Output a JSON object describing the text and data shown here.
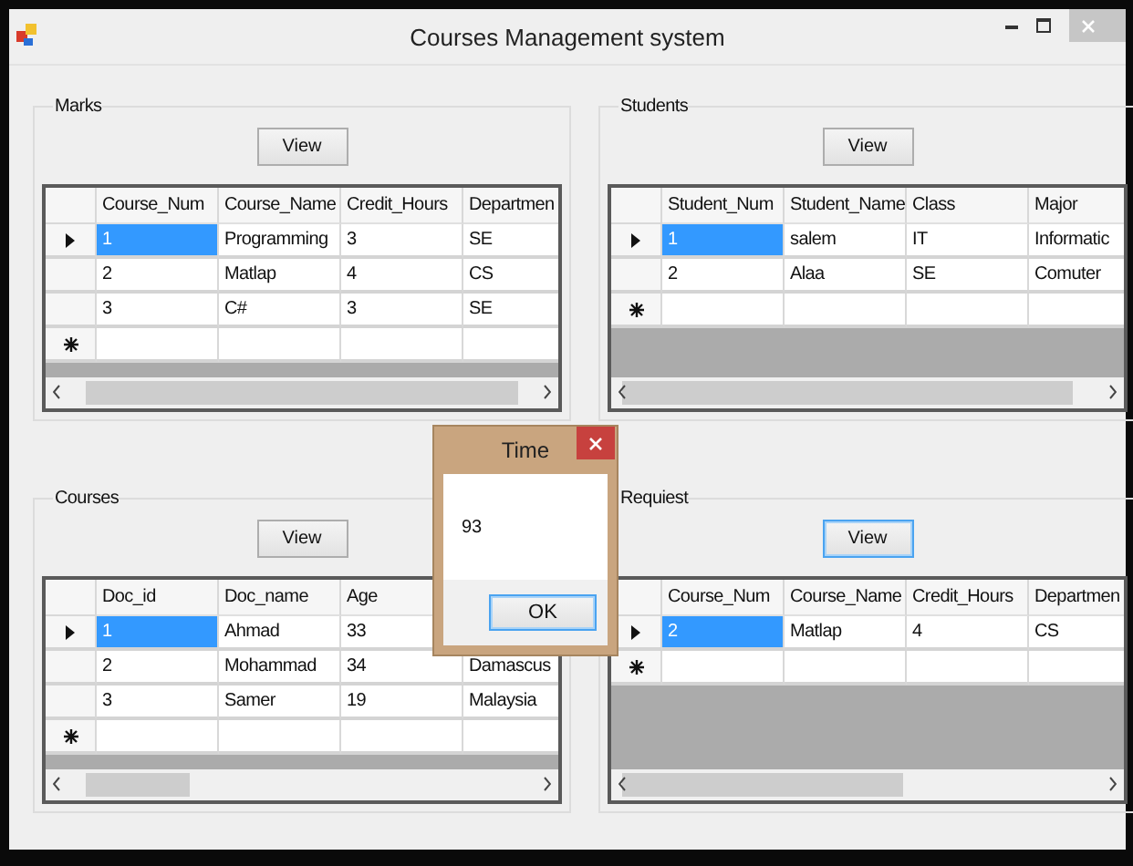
{
  "window": {
    "title": "Courses Management system"
  },
  "groups": [
    {
      "title": "Marks",
      "button": {
        "label": "View",
        "focused": false
      },
      "grid": {
        "columns": [
          "Course_Num",
          "Course_Name",
          "Credit_Hours",
          "Departmen"
        ],
        "new_row": true,
        "rows": [
          {
            "selected": true,
            "cells": [
              "1",
              "Programming",
              "3",
              "SE"
            ]
          },
          {
            "selected": false,
            "cells": [
              "2",
              "Matlap",
              "4",
              "CS"
            ]
          },
          {
            "selected": false,
            "cells": [
              "3",
              "C#",
              "3",
              "SE"
            ]
          }
        ]
      }
    },
    {
      "title": "Students",
      "button": {
        "label": "View",
        "focused": false
      },
      "grid": {
        "columns": [
          "Student_Num",
          "Student_Name",
          "Class",
          "Major"
        ],
        "new_row": true,
        "rows": [
          {
            "selected": true,
            "cells": [
              "1",
              "salem",
              "IT",
              "Informatic"
            ]
          },
          {
            "selected": false,
            "cells": [
              "2",
              "Alaa",
              "SE",
              "Comuter"
            ]
          }
        ]
      }
    },
    {
      "title": "Courses",
      "button": {
        "label": "View",
        "focused": false
      },
      "grid": {
        "columns": [
          "Doc_id",
          "Doc_name",
          "Age"
        ],
        "new_row": true,
        "rows": [
          {
            "selected": true,
            "cells": [
              "1",
              "Ahmad",
              "33"
            ]
          },
          {
            "selected": false,
            "cells": [
              "2",
              "Mohammad",
              "34",
              "Damascus"
            ]
          },
          {
            "selected": false,
            "cells": [
              "3",
              "Samer",
              "19",
              "Malaysia"
            ]
          }
        ]
      }
    },
    {
      "title": "Requiest",
      "button": {
        "label": "View",
        "focused": true
      },
      "grid": {
        "columns": [
          "Course_Num",
          "Course_Name",
          "Credit_Hours",
          "Departmen"
        ],
        "new_row": true,
        "rows": [
          {
            "selected": true,
            "cells": [
              "2",
              "Matlap",
              "4",
              "CS"
            ]
          }
        ]
      }
    }
  ],
  "dialog": {
    "title": "Time",
    "message": "93",
    "button": {
      "label": "OK",
      "focused": true
    }
  }
}
